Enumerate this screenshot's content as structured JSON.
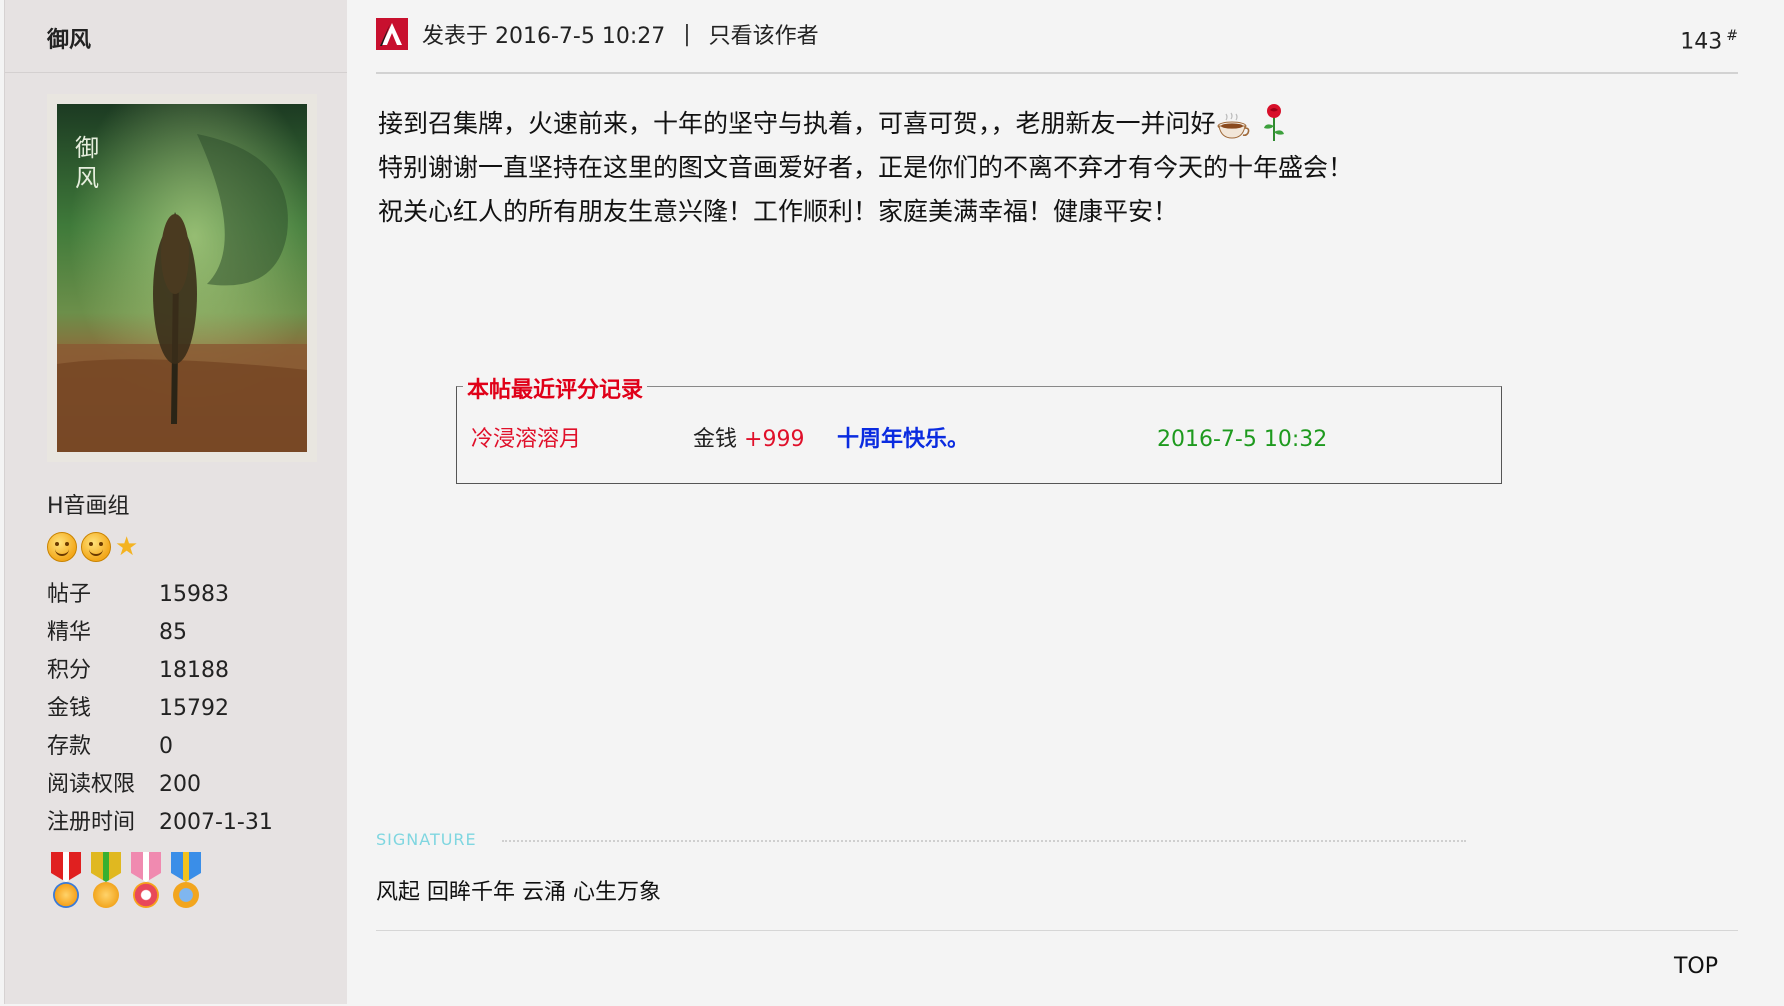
{
  "author": {
    "name": "御风",
    "avatar_caption": "御\n风",
    "group": "H音画组",
    "rank_icons": [
      "smile-icon",
      "smile-icon",
      "star-icon"
    ],
    "stats": [
      {
        "label": "帖子",
        "value": "15983"
      },
      {
        "label": "精华",
        "value": "85"
      },
      {
        "label": "积分",
        "value": "18188"
      },
      {
        "label": "金钱",
        "value": "15792"
      },
      {
        "label": "存款",
        "value": "0"
      },
      {
        "label": "阅读权限",
        "value": "200"
      },
      {
        "label": "注册时间",
        "value": "2007-1-31"
      }
    ],
    "medals": [
      {
        "ribbon": "#e02020",
        "disc": "#f6a21c"
      },
      {
        "ribbon": "#e0b820",
        "disc": "#f2a51e"
      },
      {
        "ribbon": "#f08ab0",
        "disc": "#e8485a"
      },
      {
        "ribbon": "#3a8ee8",
        "disc": "#f2a51e"
      }
    ]
  },
  "post": {
    "posted_at": "发表于 2016-7-5 10:27",
    "separator": "|",
    "only_author": "只看该作者",
    "floor": "143",
    "floor_mark": "#",
    "lines": [
      "接到召集牌，火速前来，十年的坚守与执着，可喜可贺，，老朋新友一并问好",
      "特别谢谢一直坚持在这里的图文音画爱好者，正是你们的不离不弃才有今天的十年盛会！",
      "祝关心红人的所有朋友生意兴隆！工作顺利！家庭美满幸福！健康平安！"
    ],
    "rating": {
      "legend": "本帖最近评分记录",
      "entries": [
        {
          "user": "冷浸溶溶月",
          "field": "金钱",
          "amount": "+999",
          "reason": "十周年快乐。",
          "time": "2016-7-5 10:32"
        }
      ]
    },
    "signature_label": "SIGNATURE",
    "signature": "风起 回眸千年 云涌 心生万象",
    "top_link": "TOP"
  },
  "colors": {
    "sidebar_bg": "#e6e2e2",
    "rating_red": "#e00018",
    "reason_blue": "#0a2be0",
    "time_green": "#1e9a1e",
    "signature_cyan": "#7fd6e0"
  }
}
